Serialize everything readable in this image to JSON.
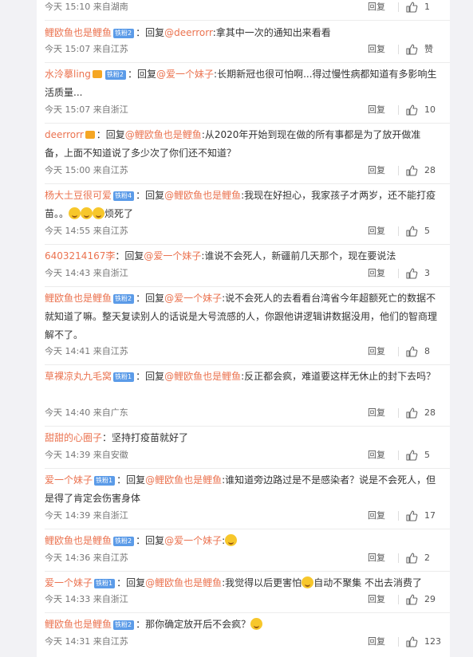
{
  "reply_label": "回复",
  "like_icon": "thumbs-up-icon",
  "comments": [
    {
      "segments": [],
      "time": "今天 15:10",
      "from": "来自湖南",
      "likes": "1"
    },
    {
      "segments": [
        {
          "t": "user",
          "v": "鲤欧鱼也是鲤鱼"
        },
        {
          "t": "badge",
          "v": "铁粉2"
        },
        {
          "t": "text",
          "v": "：回复"
        },
        {
          "t": "user",
          "v": "@deerrorr"
        },
        {
          "t": "text",
          "v": ":拿其中一次的通知出来看看"
        }
      ],
      "time": "今天 15:07",
      "from": "来自江苏",
      "likes": "赞"
    },
    {
      "segments": [
        {
          "t": "user",
          "v": "水泠摹ling"
        },
        {
          "t": "vip",
          "v": ""
        },
        {
          "t": "badge",
          "v": "铁粉2"
        },
        {
          "t": "text",
          "v": "：回复"
        },
        {
          "t": "user",
          "v": "@爱一个妹子"
        },
        {
          "t": "text",
          "v": ":长期新冠也很可怕啊...得过慢性病都知道有多影响生活质量..."
        }
      ],
      "time": "今天 15:07",
      "from": "来自浙江",
      "likes": "10"
    },
    {
      "segments": [
        {
          "t": "user",
          "v": "deerrorr"
        },
        {
          "t": "vip",
          "v": ""
        },
        {
          "t": "text",
          "v": "：回复"
        },
        {
          "t": "user",
          "v": "@鲤欧鱼也是鲤鱼"
        },
        {
          "t": "text",
          "v": ":从2020年开始到现在做的所有事都是为了放开做准备，上面不知道说了多少次了你们还不知道？"
        }
      ],
      "time": "今天 15:00",
      "from": "来自江苏",
      "likes": "28"
    },
    {
      "segments": [
        {
          "t": "user",
          "v": "杨大土豆很可爱"
        },
        {
          "t": "badge",
          "v": "铁粉4"
        },
        {
          "t": "text",
          "v": "：回复"
        },
        {
          "t": "user",
          "v": "@鲤欧鱼也是鲤鱼"
        },
        {
          "t": "text",
          "v": ":我现在好担心，我家孩子才两岁，还不能打疫苗。。"
        },
        {
          "t": "emoji",
          "v": ""
        },
        {
          "t": "emoji",
          "v": ""
        },
        {
          "t": "emoji",
          "v": ""
        },
        {
          "t": "text",
          "v": "烦死了"
        }
      ],
      "time": "今天 14:55",
      "from": "来自江苏",
      "likes": "5"
    },
    {
      "segments": [
        {
          "t": "user",
          "v": "6403214167李"
        },
        {
          "t": "text",
          "v": "：回复"
        },
        {
          "t": "user",
          "v": "@爱一个妹子"
        },
        {
          "t": "text",
          "v": ":谁说不会死人，新疆前几天那个，现在要说法"
        }
      ],
      "time": "今天 14:43",
      "from": "来自浙江",
      "likes": "3"
    },
    {
      "segments": [
        {
          "t": "user",
          "v": "鲤欧鱼也是鲤鱼"
        },
        {
          "t": "badge",
          "v": "铁粉2"
        },
        {
          "t": "text",
          "v": "：回复"
        },
        {
          "t": "user",
          "v": "@爱一个妹子"
        },
        {
          "t": "text",
          "v": ":说不会死人的去看看台湾省今年超额死亡的数据不就知道了嘛。整天复读别人的话说是大号流感的人，你跟他讲逻辑讲数据没用，他们的智商理解不了。"
        }
      ],
      "time": "今天 14:41",
      "from": "来自江苏",
      "likes": "8"
    },
    {
      "segments": [
        {
          "t": "user",
          "v": "草裸凉丸九毛窝"
        },
        {
          "t": "badge",
          "v": "铁粉1"
        },
        {
          "t": "text",
          "v": "：回复"
        },
        {
          "t": "user",
          "v": "@鲤欧鱼也是鲤鱼"
        },
        {
          "t": "text",
          "v": ":反正都会疯，难道要这样无休止的封下去吗？"
        }
      ],
      "time": "今天 14:40",
      "from": "来自广东",
      "likes": "28"
    },
    {
      "segments": [
        {
          "t": "user",
          "v": "甜甜的心圈子"
        },
        {
          "t": "text",
          "v": "：坚持打疫苗就好了"
        }
      ],
      "time": "今天 14:39",
      "from": "来自安徽",
      "likes": "5"
    },
    {
      "segments": [
        {
          "t": "user",
          "v": "爱一个妹子"
        },
        {
          "t": "badge",
          "v": "铁粉1"
        },
        {
          "t": "text",
          "v": "：回复"
        },
        {
          "t": "user",
          "v": "@鲤欧鱼也是鲤鱼"
        },
        {
          "t": "text",
          "v": ":谁知道旁边路过是不是感染者？说是不会死人，但是得了肯定会伤害身体"
        }
      ],
      "time": "今天 14:39",
      "from": "来自浙江",
      "likes": "17"
    },
    {
      "segments": [
        {
          "t": "user",
          "v": "鲤欧鱼也是鲤鱼"
        },
        {
          "t": "badge",
          "v": "铁粉2"
        },
        {
          "t": "text",
          "v": "：回复"
        },
        {
          "t": "user",
          "v": "@爱一个妹子"
        },
        {
          "t": "text",
          "v": ":"
        },
        {
          "t": "emoji",
          "v": ""
        }
      ],
      "time": "今天 14:36",
      "from": "来自江苏",
      "likes": "2"
    },
    {
      "segments": [
        {
          "t": "user",
          "v": "爱一个妹子"
        },
        {
          "t": "badge",
          "v": "铁粉1"
        },
        {
          "t": "text",
          "v": "：回复"
        },
        {
          "t": "user",
          "v": "@鲤欧鱼也是鲤鱼"
        },
        {
          "t": "text",
          "v": ":我觉得以后更害怕"
        },
        {
          "t": "emoji",
          "v": ""
        },
        {
          "t": "text",
          "v": "自动不聚集 不出去消费了"
        }
      ],
      "time": "今天 14:33",
      "from": "来自浙江",
      "likes": "29"
    },
    {
      "segments": [
        {
          "t": "user",
          "v": "鲤欧鱼也是鲤鱼"
        },
        {
          "t": "badge",
          "v": "铁粉2"
        },
        {
          "t": "text",
          "v": "：那你确定放开后不会疯？"
        },
        {
          "t": "emoji",
          "v": ""
        }
      ],
      "time": "今天 14:31",
      "from": "来自江苏",
      "likes": "123"
    }
  ]
}
